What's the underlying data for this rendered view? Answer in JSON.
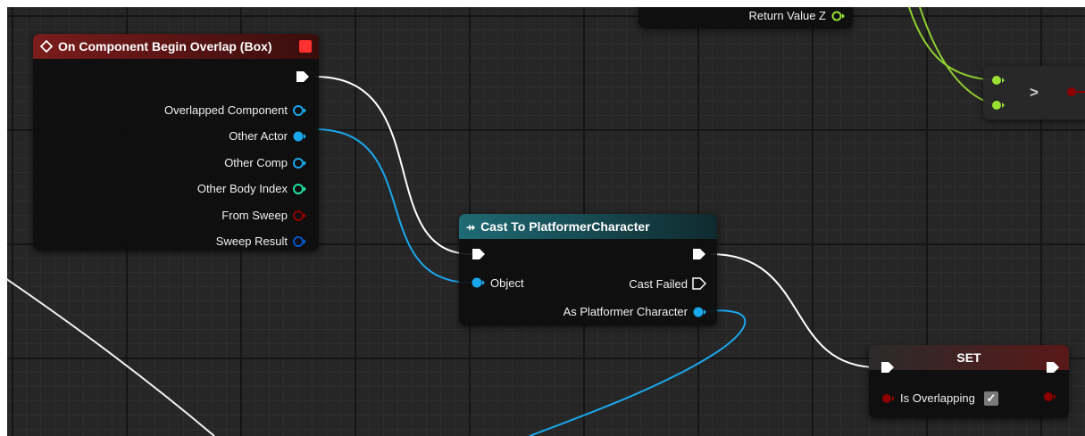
{
  "top_node": {
    "pin_return_value_z": "Return Value Z"
  },
  "compare_node": {
    "operator": ">"
  },
  "overlap_event": {
    "title": "On Component Begin Overlap (Box)",
    "pins": {
      "overlapped_component": "Overlapped Component",
      "other_actor": "Other Actor",
      "other_comp": "Other Comp",
      "other_body_index": "Other Body Index",
      "from_sweep": "From Sweep",
      "sweep_result": "Sweep Result"
    },
    "header_color": "#6b1a1a"
  },
  "cast_node": {
    "title": "Cast To PlatformerCharacter",
    "pins": {
      "object": "Object",
      "cast_failed": "Cast Failed",
      "as_platformer_character": "As Platformer Character"
    },
    "header_color": "#1c5c66"
  },
  "set_node": {
    "title": "SET",
    "pins": {
      "is_overlapping": "Is Overlapping"
    },
    "checked": true,
    "header_color": "#4a1515"
  },
  "colors": {
    "object_pin": "#1aa7ec",
    "int_pin": "#1fe0a0",
    "bool_pin": "#8e0000",
    "float_pin": "#9ae031",
    "struct_pin": "#0058c8",
    "exec_pin": "#ffffff"
  }
}
